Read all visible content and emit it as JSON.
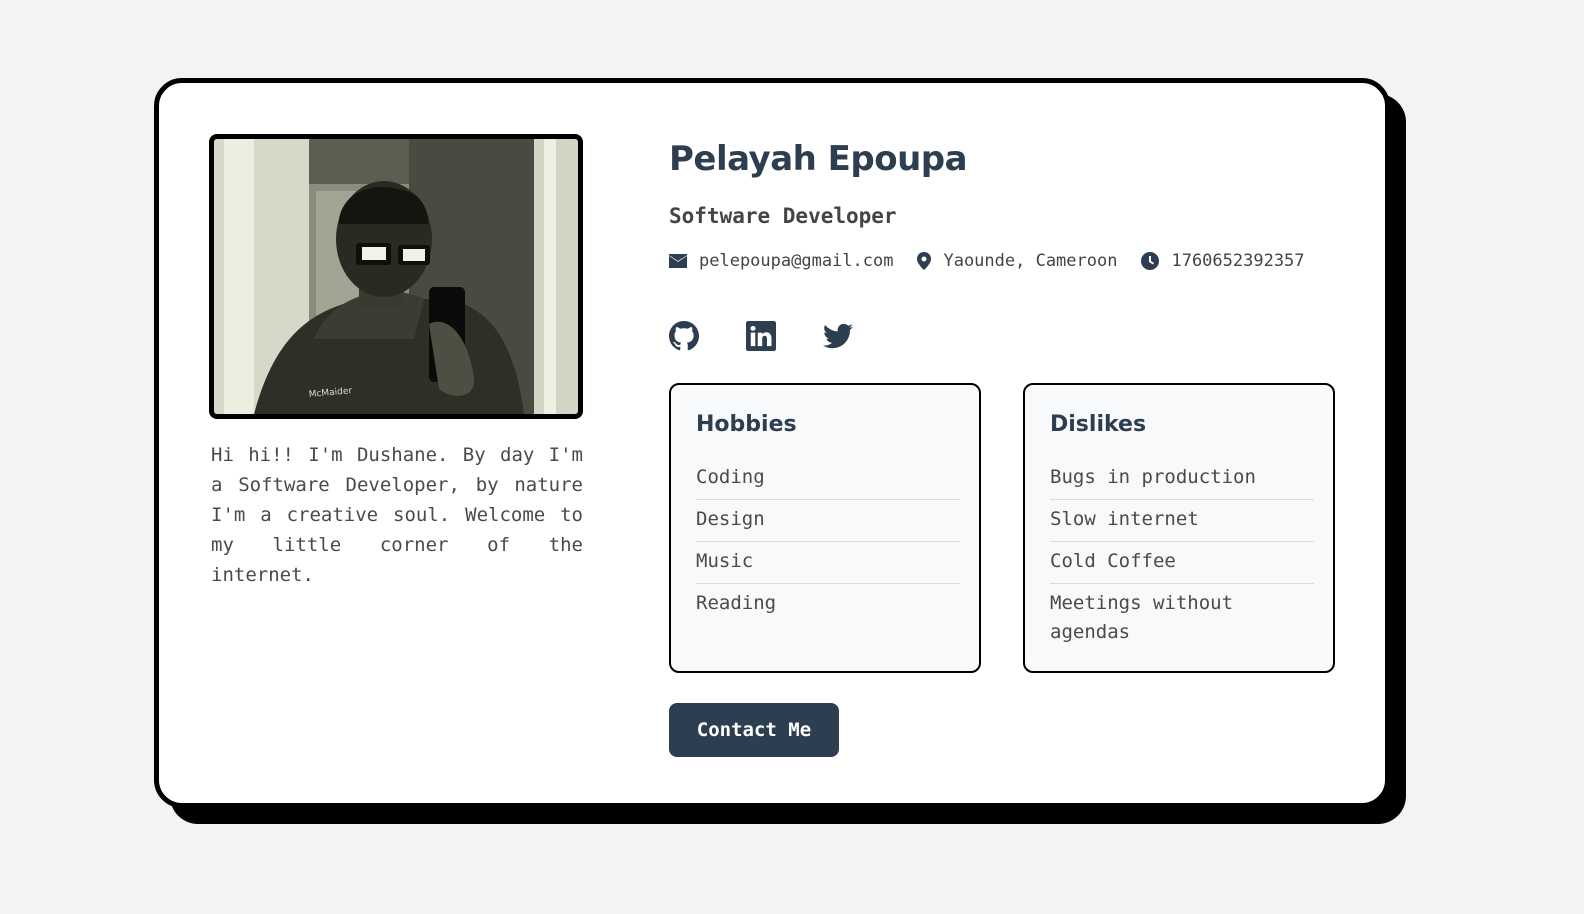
{
  "profile": {
    "name": "Pelayah Epoupa",
    "role": "Software Developer",
    "bio": "Hi hi!! I'm Dushane. By day I'm a Software Developer, by nature I'm a creative soul. Welcome to my little corner of the internet.",
    "photo_alt_icon": "profile-photo"
  },
  "contact": {
    "email": "pelepoupa@gmail.com",
    "location": "Yaounde, Cameroon",
    "phone": "1760652392357"
  },
  "socials": [
    {
      "icon": "github-icon"
    },
    {
      "icon": "linkedin-icon"
    },
    {
      "icon": "twitter-icon"
    }
  ],
  "hobbies": {
    "title": "Hobbies",
    "items": [
      "Coding",
      "Design",
      "Music",
      "Reading"
    ]
  },
  "dislikes": {
    "title": "Dislikes",
    "items": [
      "Bugs in production",
      "Slow internet",
      "Cold Coffee",
      "Meetings without agendas"
    ]
  },
  "actions": {
    "contact_label": "Contact Me"
  },
  "colors": {
    "accent": "#2d3e50",
    "background": "#f3f3f3",
    "card": "#ffffff",
    "border": "#000000"
  }
}
